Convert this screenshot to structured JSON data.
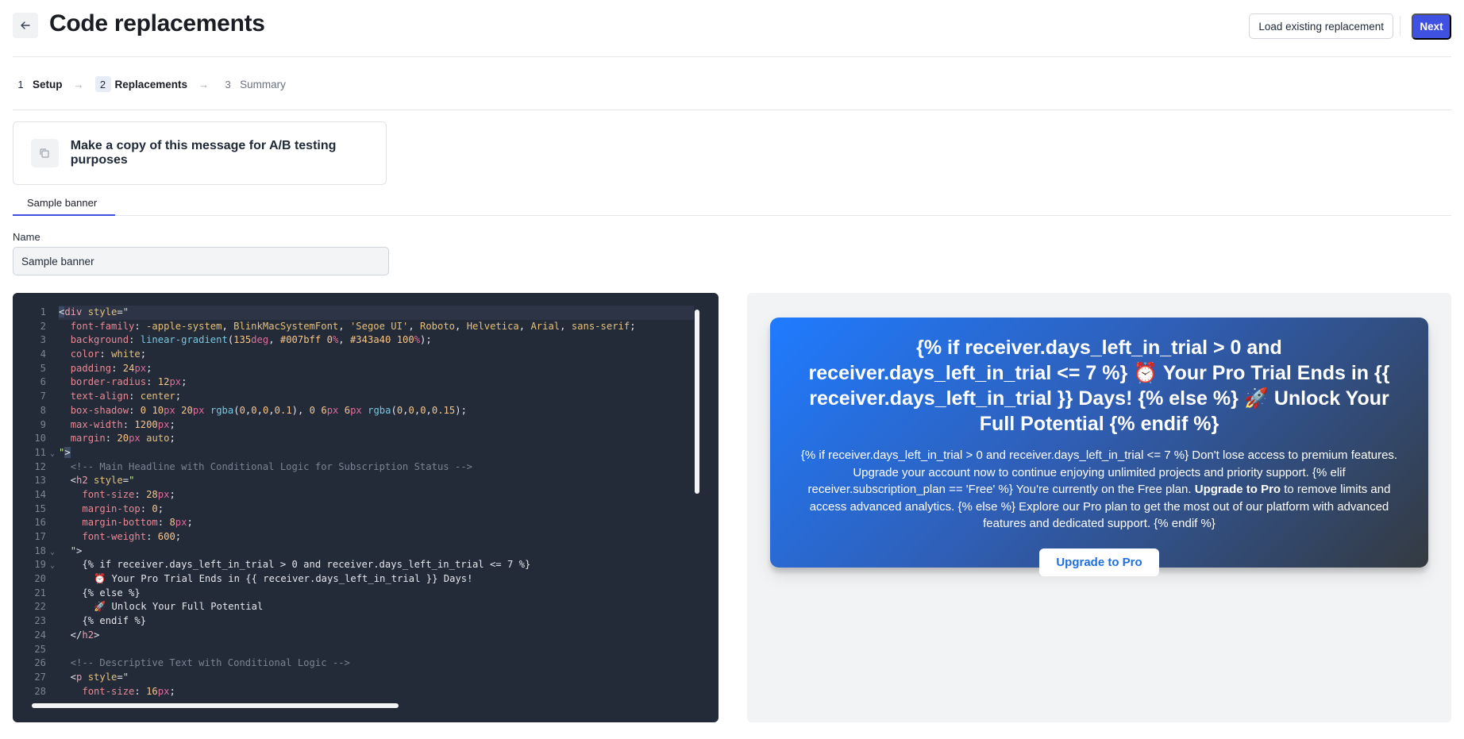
{
  "header": {
    "title": "Code replacements",
    "load_button": "Load existing replacement",
    "next_button": "Next"
  },
  "steps": [
    {
      "num": "1",
      "label": "Setup"
    },
    {
      "num": "2",
      "label": "Replacements"
    },
    {
      "num": "3",
      "label": "Summary"
    }
  ],
  "step_arrow": "→",
  "copy_card": {
    "label": "Make a copy of this message for A/B testing purposes"
  },
  "tabs": [
    {
      "label": "Sample banner"
    }
  ],
  "name_field": {
    "label": "Name",
    "value": "Sample banner"
  },
  "editor": {
    "line_numbers": [
      "1",
      "2",
      "3",
      "4",
      "5",
      "6",
      "7",
      "8",
      "9",
      "10",
      "11",
      "12",
      "13",
      "14",
      "15",
      "16",
      "17",
      "18",
      "19",
      "20",
      "21",
      "22",
      "23",
      "24",
      "25",
      "26",
      "27",
      "28"
    ],
    "fold_marker": "⌄"
  },
  "preview": {
    "headline": "{% if receiver.days_left_in_trial > 0 and receiver.days_left_in_trial <= 7 %} ⏰ Your Pro Trial Ends in {{ receiver.days_left_in_trial }} Days! {% else %} 🚀 Unlock Your Full Potential {% endif %}",
    "body_pre": "{% if receiver.days_left_in_trial > 0 and receiver.days_left_in_trial <= 7 %} Don't lose access to premium features. Upgrade your account now to continue enjoying unlimited projects and priority support. {% elif receiver.subscription_plan == 'Free' %} You're currently on the Free plan. ",
    "body_bold": "Upgrade to Pro",
    "body_post": " to remove limits and access advanced analytics. {% else %} Explore our Pro plan to get the most out of our platform with advanced features and dedicated support. {% endif %}",
    "button": "Upgrade to Pro"
  }
}
